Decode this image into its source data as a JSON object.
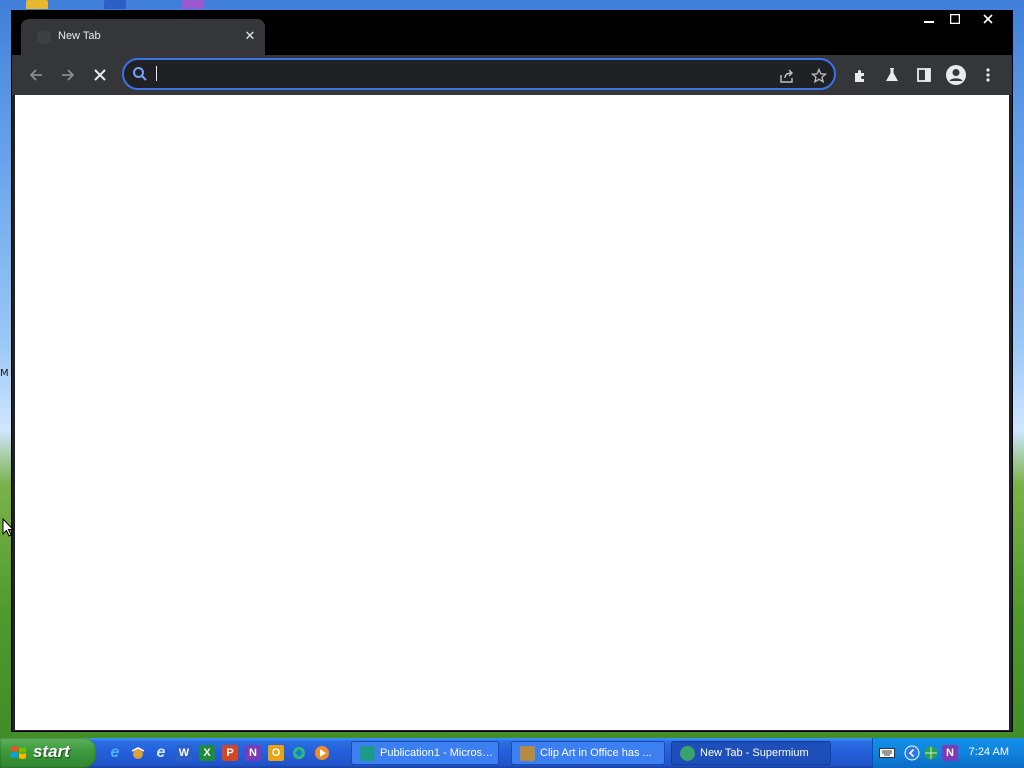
{
  "browser": {
    "tab": {
      "title": "New Tab",
      "close_icon": "close-icon"
    },
    "window_controls": {
      "minimize": "–",
      "maximize": "□",
      "close": "✕"
    },
    "toolbar": {
      "back": "back-icon",
      "forward": "forward-icon",
      "stop": "close-icon",
      "omnibox": {
        "value": "",
        "placeholder": ""
      },
      "actions": [
        "share-icon",
        "star-icon",
        "extensions-icon",
        "labs-icon",
        "side-panel-icon",
        "profile-icon",
        "menu-icon"
      ]
    }
  },
  "taskbar": {
    "start_label": "start",
    "quick_launch": [
      "ie-icon",
      "outlook-express-icon",
      "ie-alt-icon",
      "word-icon",
      "excel-icon",
      "powerpoint-icon",
      "onenote-icon",
      "outlook-icon",
      "messenger-icon",
      "media-icon"
    ],
    "quick_launch_letters": {
      "word": "W",
      "excel": "X",
      "powerpoint": "P",
      "onenote": "N",
      "outlook": "O"
    },
    "tasks": [
      {
        "label": "Publication1 - Microso...",
        "active": false
      },
      {
        "label": "Clip Art in Office has ...",
        "active": false
      },
      {
        "label": "New Tab - Supermium",
        "active": true
      }
    ],
    "tray": {
      "onenote_letter": "N",
      "clock": "7:24 AM"
    }
  },
  "colors": {
    "accent": "#3c73e8",
    "chrome_dark": "#35363a",
    "titlebar": "#000000",
    "taskbar_blue": "#245edb",
    "start_green": "#3c9a3c"
  }
}
